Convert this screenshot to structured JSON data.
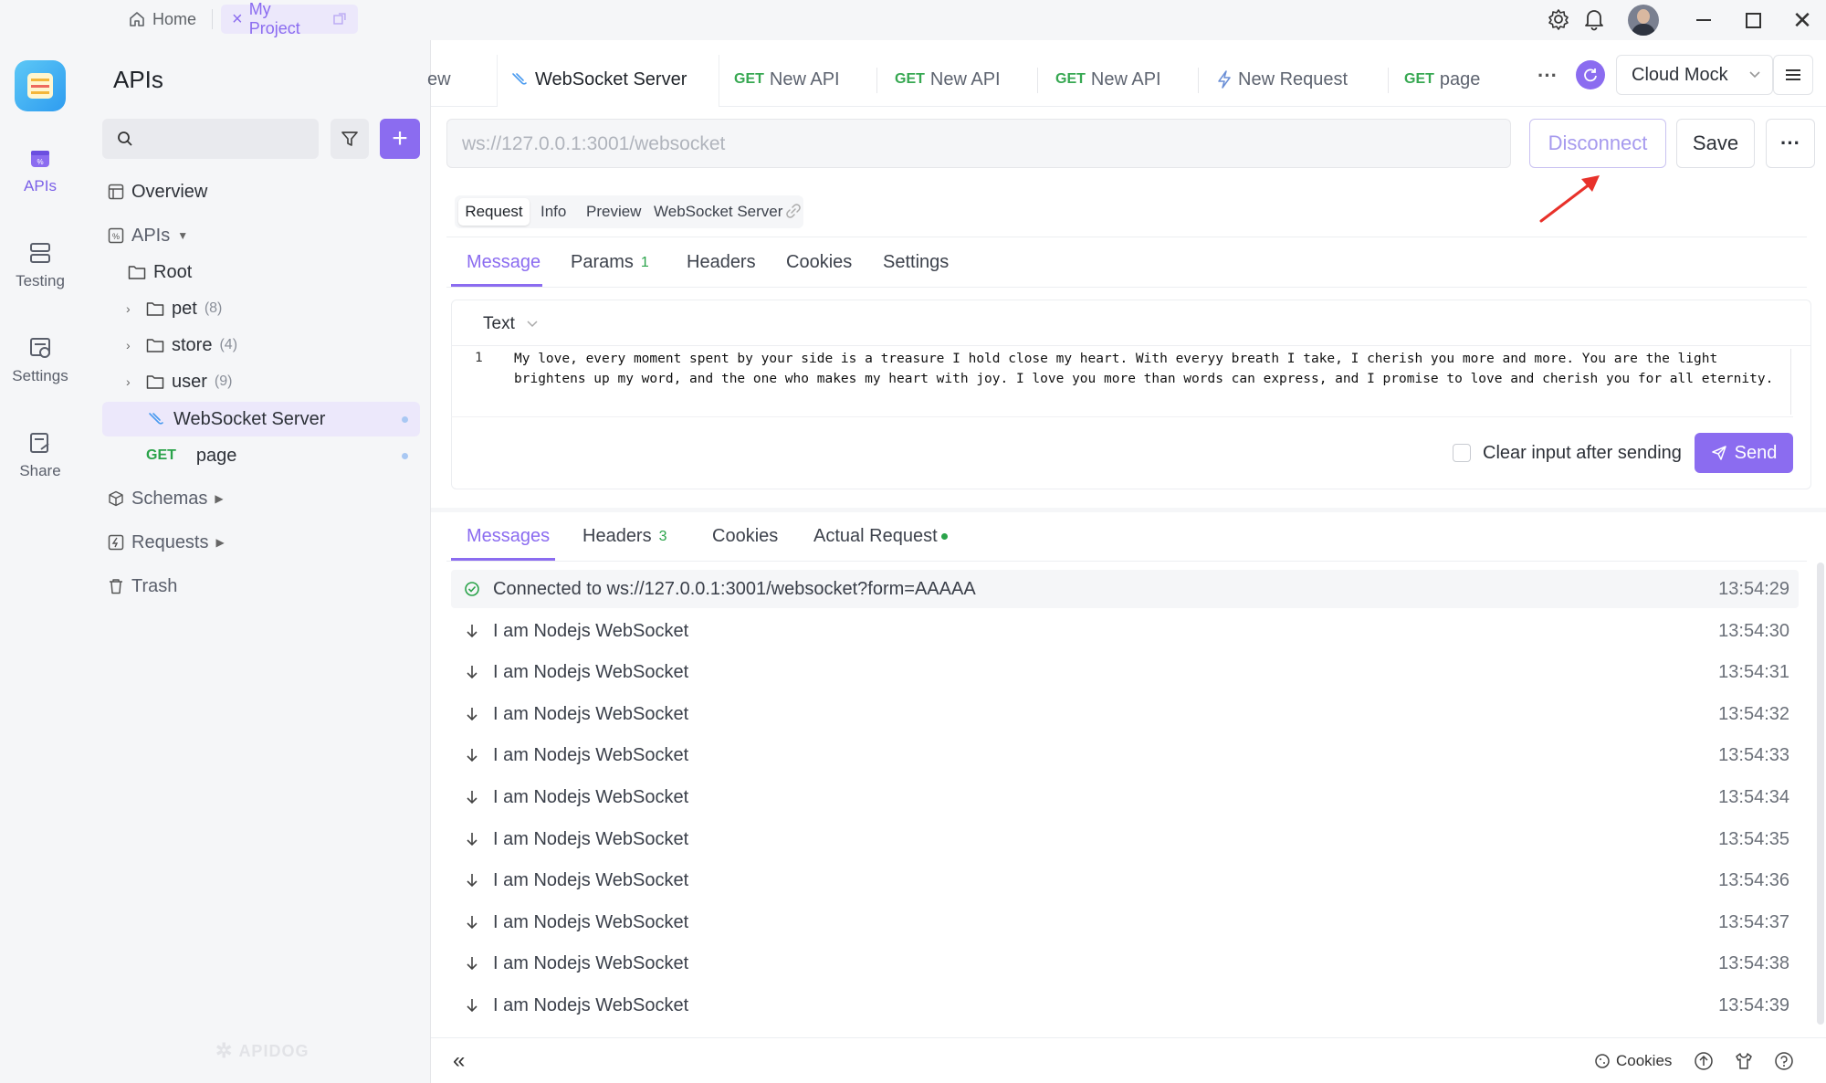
{
  "titlebar": {
    "home_label": "Home",
    "project_label": "My Project",
    "colors": {
      "project_tab_bg": "#ece8fb",
      "accent": "#8b6cf0"
    }
  },
  "rail": {
    "items": [
      {
        "label": "APIs",
        "icon": "apis-icon",
        "active": true
      },
      {
        "label": "Testing",
        "icon": "testing-icon"
      },
      {
        "label": "Settings",
        "icon": "settings-icon"
      },
      {
        "label": "Share",
        "icon": "share-icon"
      }
    ]
  },
  "tree": {
    "title": "APIs",
    "search_placeholder": "",
    "items": {
      "overview": "Overview",
      "apis": "APIs",
      "root": "Root",
      "pet": "pet",
      "pet_count": "(8)",
      "store": "store",
      "store_count": "(4)",
      "user": "user",
      "user_count": "(9)",
      "websocket": "WebSocket Server",
      "page_method": "GET",
      "page": "page",
      "schemas": "Schemas",
      "requests": "Requests",
      "trash": "Trash"
    },
    "watermark": "APIDOG"
  },
  "tabs": {
    "partial": "ew",
    "websocket": "WebSocket Server",
    "new_api_method": "GET",
    "new_api_1": "New API",
    "new_api_2": "New API",
    "new_api_3": "New API",
    "new_request": "New Request",
    "page_method": "GET",
    "page": "page",
    "more": "···",
    "environment": "Cloud Mock"
  },
  "url_bar": {
    "value": "ws://127.0.0.1:3001/websocket",
    "disconnect_label": "Disconnect",
    "save_label": "Save",
    "more_label": "···"
  },
  "mode_tabs": {
    "request": "Request",
    "info": "Info",
    "preview": "Preview",
    "name": "WebSocket Server"
  },
  "message_tabs": {
    "message": "Message",
    "params": "Params",
    "params_count": "1",
    "headers": "Headers",
    "cookies": "Cookies",
    "settings": "Settings"
  },
  "editor": {
    "format": "Text",
    "line_number": "1",
    "content": "My love, every moment spent by your side is a treasure I hold close my heart. With everyy breath I take, I cherish you more and more. You are the light brightens up my word, and the one who makes my heart with joy. I love you more than words can express, and I promise to love and cherish you for all eternity.",
    "clear_label": "Clear input after sending",
    "clear_checked": false,
    "send_label": "Send"
  },
  "response_tabs": {
    "messages": "Messages",
    "headers": "Headers",
    "headers_count": "3",
    "cookies": "Cookies",
    "actual_request": "Actual Request"
  },
  "messages": [
    {
      "kind": "connected",
      "text": "Connected to ws://127.0.0.1:3001/websocket?form=AAAAA",
      "time": "13:54:29"
    },
    {
      "kind": "received",
      "text": "I am Nodejs WebSocket",
      "time": "13:54:30"
    },
    {
      "kind": "received",
      "text": "I am Nodejs WebSocket",
      "time": "13:54:31"
    },
    {
      "kind": "received",
      "text": "I am Nodejs WebSocket",
      "time": "13:54:32"
    },
    {
      "kind": "received",
      "text": "I am Nodejs WebSocket",
      "time": "13:54:33"
    },
    {
      "kind": "received",
      "text": "I am Nodejs WebSocket",
      "time": "13:54:34"
    },
    {
      "kind": "received",
      "text": "I am Nodejs WebSocket",
      "time": "13:54:35"
    },
    {
      "kind": "received",
      "text": "I am Nodejs WebSocket",
      "time": "13:54:36"
    },
    {
      "kind": "received",
      "text": "I am Nodejs WebSocket",
      "time": "13:54:37"
    },
    {
      "kind": "received",
      "text": "I am Nodejs WebSocket",
      "time": "13:54:38"
    },
    {
      "kind": "received",
      "text": "I am Nodejs WebSocket",
      "time": "13:54:39"
    }
  ],
  "footer": {
    "cookies_label": "Cookies"
  }
}
